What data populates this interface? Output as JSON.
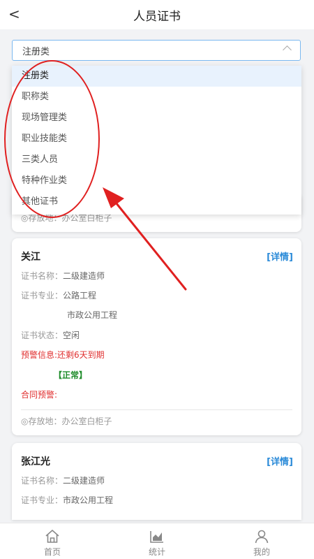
{
  "header": {
    "title": "人员证书",
    "back_icon": "chevron-left-icon"
  },
  "filter": {
    "selected": "注册类",
    "options": [
      "注册类",
      "职称类",
      "现场管理类",
      "职业技能类",
      "三类人员",
      "特种作业类",
      "其他证书"
    ]
  },
  "top_card": {
    "storage_text": "◎存放地：办公室白柜子"
  },
  "cards": [
    {
      "name": "关江",
      "detail_label": "[详情]",
      "cert_name_label": "证书名称：",
      "cert_name": "二级建造师",
      "cert_major_label": "证书专业：",
      "majors": [
        "公路工程",
        "市政公用工程"
      ],
      "status_label": "证书状态：",
      "status": "空闲",
      "warning_text": "预警信息:还剩6天到期",
      "normal_text": "【正常】",
      "contract_warning": "合同预警:",
      "storage_text": "◎存放地：办公室白柜子"
    },
    {
      "name": "张江光",
      "detail_label": "[详情]",
      "cert_name_label": "证书名称：",
      "cert_name": "二级建造师",
      "cert_major_label": "证书专业：",
      "majors": [
        "市政公用工程"
      ]
    }
  ],
  "tabbar": [
    {
      "label": "首页",
      "icon": "home-icon"
    },
    {
      "label": "统计",
      "icon": "chart-icon"
    },
    {
      "label": "我的",
      "icon": "user-icon"
    }
  ],
  "colors": {
    "accent": "#2a8ad8",
    "warning": "#e03030",
    "ok": "#1e8c2a",
    "annotation": "#e02020"
  }
}
